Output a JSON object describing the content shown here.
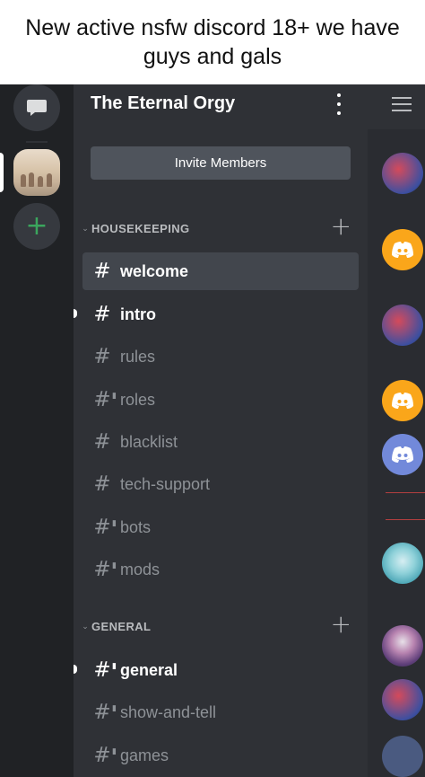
{
  "caption": "New active nsfw discord 18+ we have guys and gals",
  "server": {
    "name": "The Eternal Orgy",
    "invite_label": "Invite Members"
  },
  "categories": [
    {
      "label": "HOUSEKEEPING",
      "channels": [
        {
          "name": "welcome",
          "locked": false,
          "selected": true,
          "unread": false
        },
        {
          "name": "intro",
          "locked": false,
          "selected": false,
          "unread": true
        },
        {
          "name": "rules",
          "locked": false,
          "selected": false,
          "unread": false
        },
        {
          "name": "roles",
          "locked": true,
          "selected": false,
          "unread": false
        },
        {
          "name": "blacklist",
          "locked": false,
          "selected": false,
          "unread": false
        },
        {
          "name": "tech-support",
          "locked": false,
          "selected": false,
          "unread": false
        },
        {
          "name": "bots",
          "locked": true,
          "selected": false,
          "unread": false
        },
        {
          "name": "mods",
          "locked": true,
          "selected": false,
          "unread": false
        }
      ]
    },
    {
      "label": "GENERAL",
      "channels": [
        {
          "name": "general",
          "locked": true,
          "selected": false,
          "unread": true
        },
        {
          "name": "show-and-tell",
          "locked": true,
          "selected": false,
          "unread": false
        },
        {
          "name": "games",
          "locked": true,
          "selected": false,
          "unread": false
        }
      ]
    }
  ],
  "icons": {
    "dm": "chat-bubble-icon",
    "add_server": "plus-icon",
    "more": "kebab-menu-icon",
    "members": "hamburger-icon",
    "channel": "hash-icon",
    "locked_channel": "locked-hash-icon",
    "add_channel": "plus-icon",
    "collapse": "chevron-down-icon"
  },
  "colors": {
    "rail_bg": "#202225",
    "panel_bg": "#2f3136",
    "selected_bg": "#42464d",
    "invite_bg": "#4f545c",
    "add_green": "#3ba55d",
    "muted_text": "#8e9297",
    "discord_orange": "#faa61a",
    "discord_blurple": "#7289da"
  }
}
